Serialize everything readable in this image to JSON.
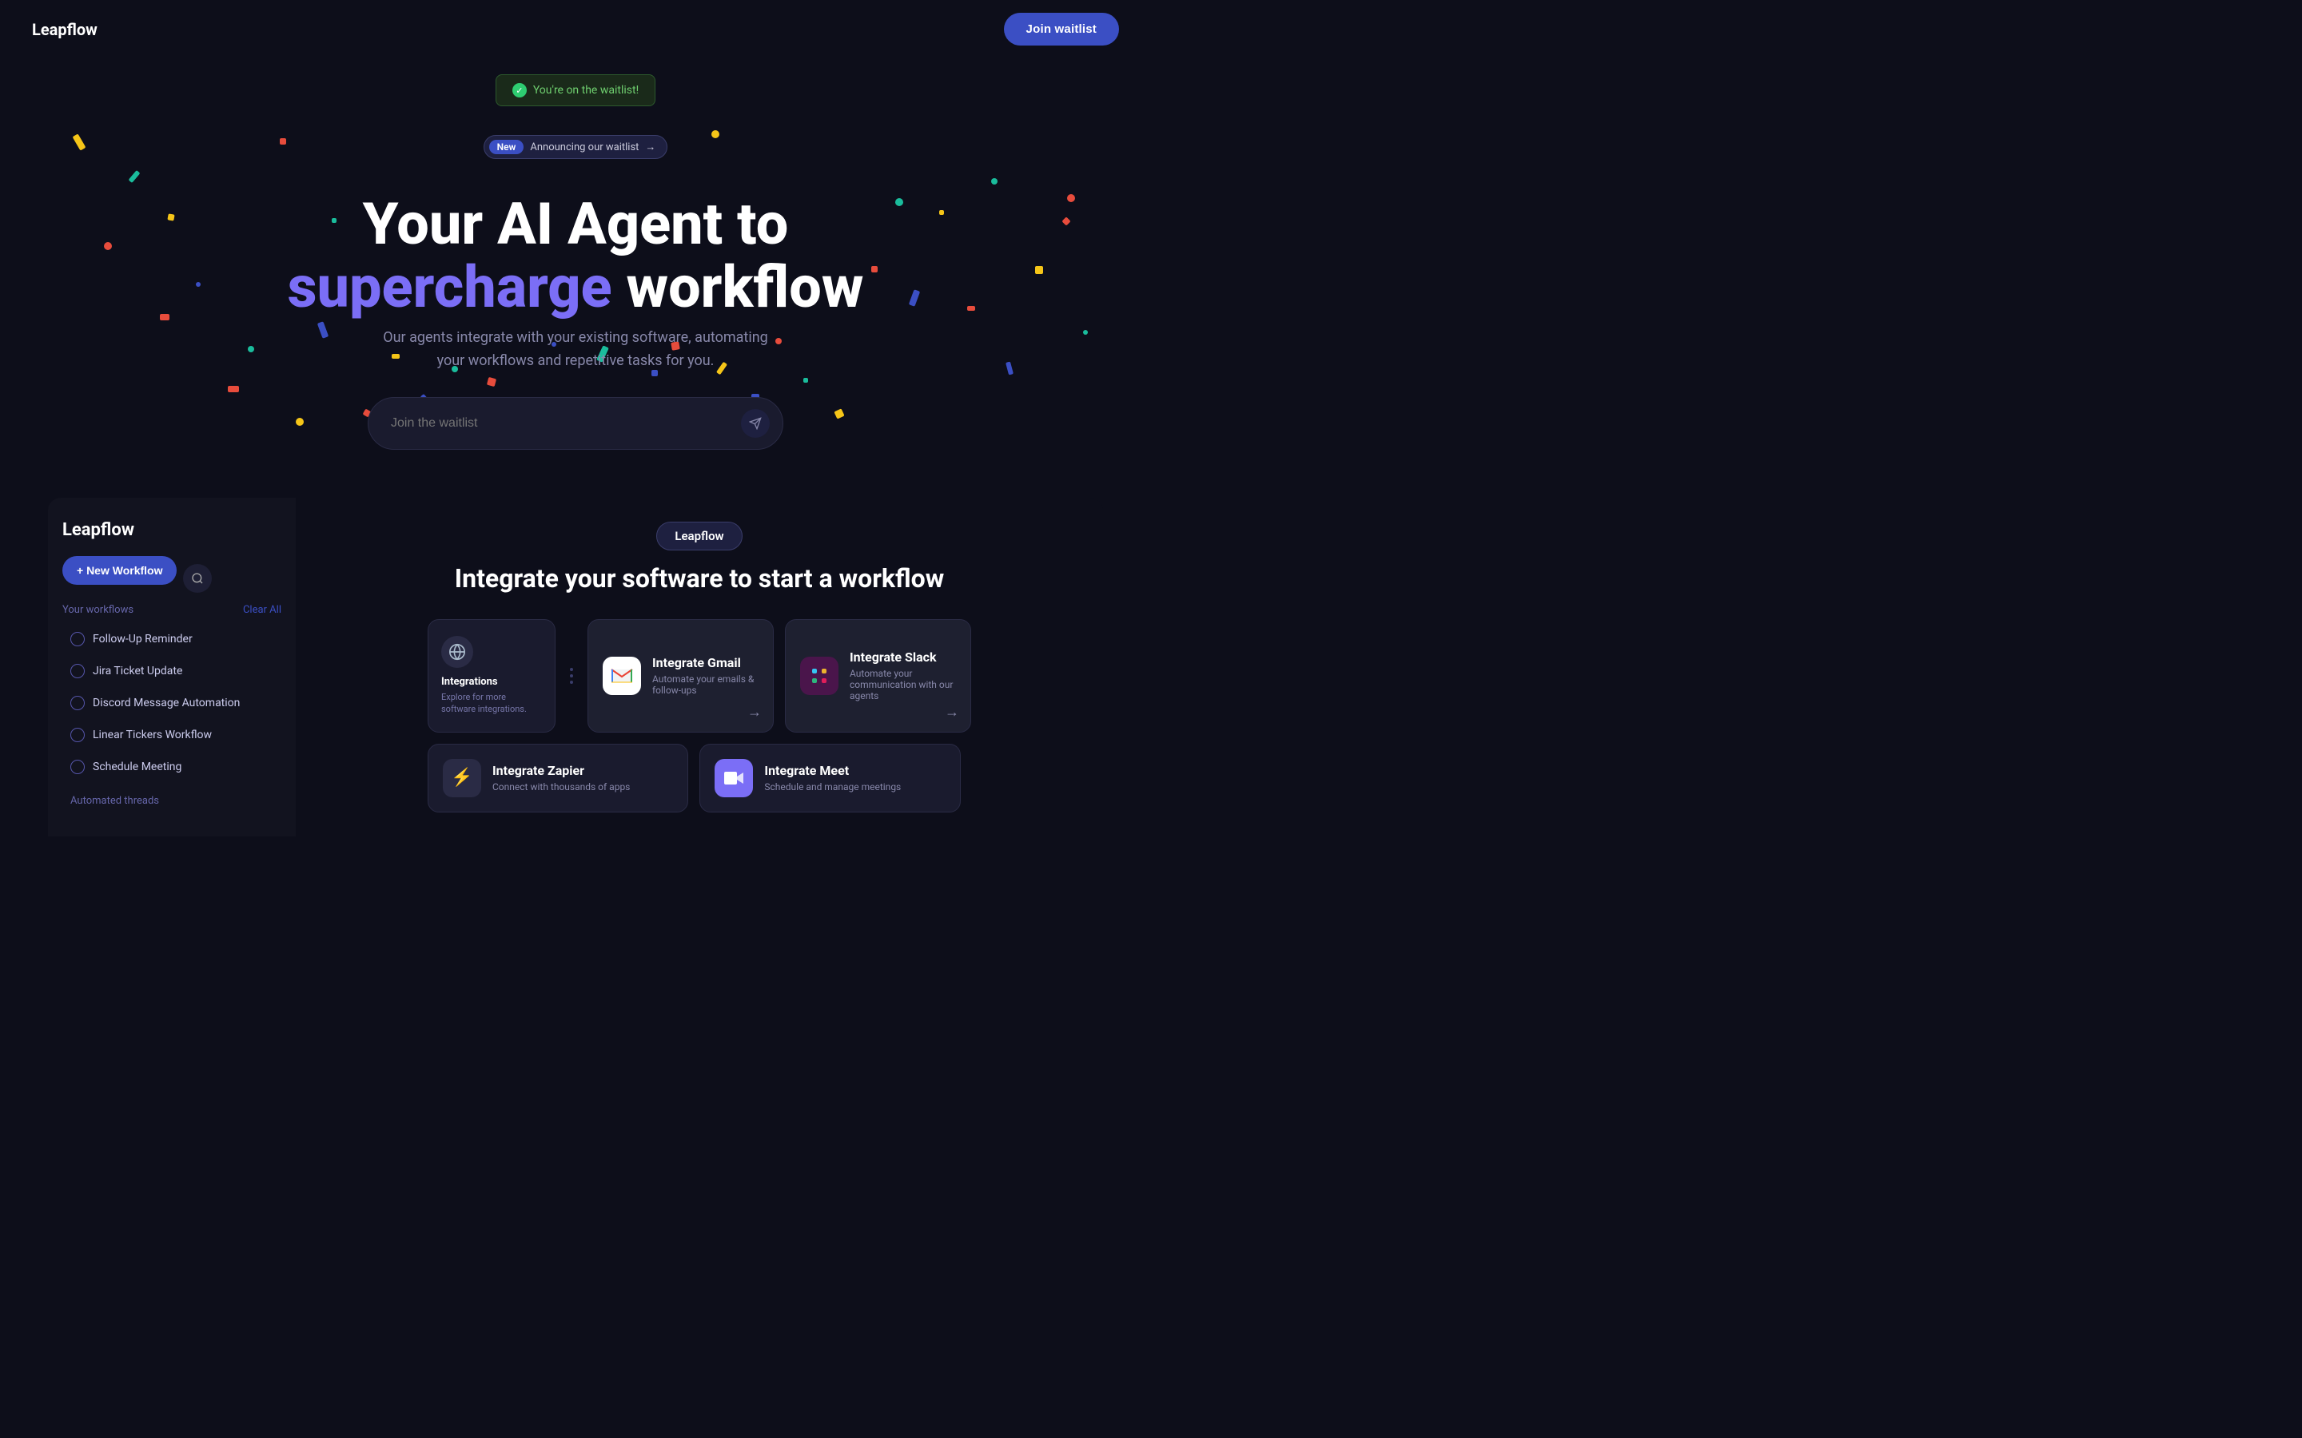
{
  "nav": {
    "logo": "Leapflow",
    "join_button": "Join waitlist"
  },
  "hero": {
    "success_banner": "You're on the waitlist!",
    "announce_new": "New",
    "announce_text": "Announcing our waitlist",
    "announce_arrow": "→",
    "title_line1": "Your AI Agent to",
    "title_line2_purple": "supercharge",
    "title_line2_rest": " workflow",
    "subtitle": "Our agents integrate with your existing software, automating your workflows and repetitive tasks for you.",
    "input_placeholder": "Join the waitlist"
  },
  "sidebar": {
    "logo": "Leapflow",
    "new_workflow_btn": "+ New Workflow",
    "workflows_label": "Your workflows",
    "clear_all": "Clear All",
    "workflow_items": [
      {
        "label": "Follow-Up Reminder"
      },
      {
        "label": "Jira Ticket Update"
      },
      {
        "label": "Discord Message Automation"
      },
      {
        "label": "Linear Tickers Workflow"
      },
      {
        "label": "Schedule Meeting"
      }
    ],
    "auto_threads_label": "Automated threads"
  },
  "main": {
    "badge": "Leapflow",
    "integrate_title": "Integrate your software to start a workflow",
    "integrations_card_small": {
      "icon_label": "🌐",
      "title": "Integrations",
      "subtitle": "Explore for more software integrations."
    },
    "integration_cards": [
      {
        "icon_type": "gmail",
        "title": "Integrate Gmail",
        "subtitle": "Automate your emails & follow-ups",
        "arrow": "→"
      },
      {
        "icon_type": "slack",
        "title": "Integrate Slack",
        "subtitle": "Automate your communication with our agents",
        "arrow": "→"
      }
    ],
    "bottom_cards": [
      {
        "icon_type": "lightning",
        "title": "Integrate Zapier",
        "subtitle": "Connect with thousands of apps"
      },
      {
        "icon_type": "meet",
        "title": "Integrate Meet",
        "subtitle": "Schedule and manage meetings"
      }
    ]
  }
}
